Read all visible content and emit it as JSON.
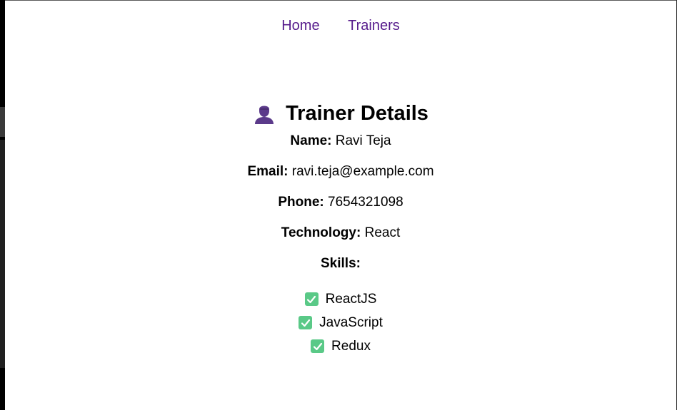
{
  "nav": {
    "links": [
      "Home",
      "Trainers"
    ]
  },
  "details": {
    "icon": "person-silhouette-icon",
    "title": "Trainer Details",
    "fields": [
      {
        "label": "Name:",
        "value": "Ravi Teja"
      },
      {
        "label": "Email:",
        "value": "ravi.teja@example.com"
      },
      {
        "label": "Phone:",
        "value": "7654321098"
      },
      {
        "label": "Technology:",
        "value": "React"
      }
    ],
    "skills_label": "Skills:",
    "skills": [
      "ReactJS",
      "JavaScript",
      "Redux"
    ],
    "skill_icon": "check-mark-button-icon"
  },
  "colors": {
    "link": "#551a8b",
    "icon": "#5b3a8a",
    "check": "#5ac987"
  }
}
